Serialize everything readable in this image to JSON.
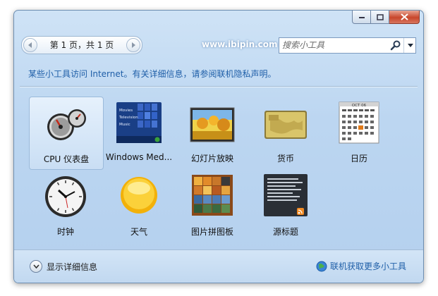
{
  "titlebar": {
    "buttons": {
      "minimize": "minimize-icon",
      "maximize": "maximize-icon",
      "close": "close-icon"
    }
  },
  "pager": {
    "text": "第 1 页，共 1 页",
    "prev_icon": "chevron-left-icon",
    "next_icon": "chevron-right-icon"
  },
  "site": "www.ibipin.com",
  "search": {
    "placeholder": "搜索小工具",
    "icon": "search-icon",
    "dropdown_icon": "dropdown-arrow-icon"
  },
  "privacy_text": "某些小工具访问 Internet。有关详细信息，请参阅联机隐私声明。",
  "gadgets": [
    {
      "label": "CPU 仪表盘",
      "icon": "cpu-meter-icon",
      "selected": true
    },
    {
      "label": "Windows Med...",
      "icon": "media-center-icon",
      "thumb_lines": [
        "Movies",
        "Television",
        "Music"
      ]
    },
    {
      "label": "幻灯片放映",
      "icon": "slideshow-icon"
    },
    {
      "label": "货币",
      "icon": "currency-icon"
    },
    {
      "label": "日历",
      "icon": "calendar-icon",
      "thumb_month": "OCT 06"
    },
    {
      "label": "时钟",
      "icon": "clock-icon"
    },
    {
      "label": "天气",
      "icon": "weather-icon"
    },
    {
      "label": "图片拼图板",
      "icon": "puzzle-icon"
    },
    {
      "label": "源标题",
      "icon": "feed-headlines-icon"
    }
  ],
  "footer": {
    "details": "显示详细信息",
    "details_icon": "chevron-down-icon",
    "online": "联机获取更多小工具",
    "online_icon": "globe-icon"
  },
  "colors": {
    "link": "#1f5fa8",
    "window_bg": "#bcd6f1",
    "selected_bg": "#d6e7f8",
    "close_red": "#c8462b"
  }
}
